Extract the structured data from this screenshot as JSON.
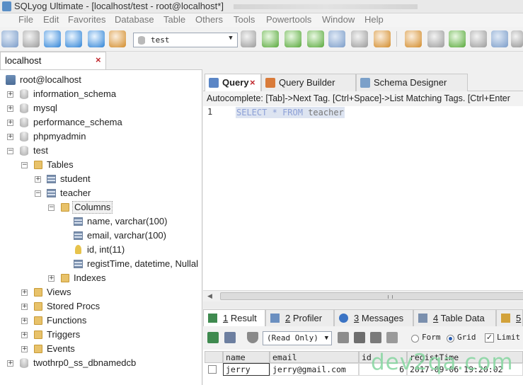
{
  "window": {
    "title": "SQLyog Ultimate - [localhost/test - root@localhost*]"
  },
  "menu": [
    "File",
    "Edit",
    "Favorites",
    "Database",
    "Table",
    "Others",
    "Tools",
    "Powertools",
    "Window",
    "Help"
  ],
  "toolbar": {
    "database_select": "test"
  },
  "connection_tab": {
    "label": "localhost",
    "close": "×"
  },
  "tree": {
    "root": "root@localhost",
    "nodes": {
      "information_schema": "information_schema",
      "mysql": "mysql",
      "performance_schema": "performance_schema",
      "phpmyadmin": "phpmyadmin",
      "test": "test",
      "tables": "Tables",
      "student": "student",
      "teacher": "teacher",
      "columns": "Columns",
      "col_name": "name, varchar(100)",
      "col_email": "email, varchar(100)",
      "col_id": "id, int(11)",
      "col_registtime": "registTime, datetime, Nullal",
      "indexes": "Indexes",
      "views": "Views",
      "stored_procs": "Stored Procs",
      "functions": "Functions",
      "triggers": "Triggers",
      "events": "Events",
      "twothrp0": "twothrp0_ss_dbnamedcb"
    },
    "expand": "+",
    "collapse": "−"
  },
  "query_tabs": [
    "Query",
    "Query Builder",
    "Schema Designer"
  ],
  "tab_close": "×",
  "autocomplete": "Autocomplete: [Tab]->Next Tag. [Ctrl+Space]->List Matching Tags. [Ctrl+Enter",
  "editor": {
    "line": "1",
    "kw1": "SELECT",
    "star": "*",
    "kw2": "FROM",
    "table": "teacher"
  },
  "result_tabs": [
    {
      "num": "1",
      "label": "Result"
    },
    {
      "num": "2",
      "label": "Profiler"
    },
    {
      "num": "3",
      "label": "Messages"
    },
    {
      "num": "4",
      "label": "Table Data"
    },
    {
      "num": "5",
      "label": ""
    }
  ],
  "result_toolbar": {
    "mode": "(Read Only)",
    "form": "Form",
    "grid": "Grid",
    "limit": "Limit",
    "limit_checked": "✓"
  },
  "grid": {
    "columns": [
      "name",
      "email",
      "id",
      "registTime"
    ],
    "rows": [
      [
        "jerry",
        "jerry@gmail.com",
        "6",
        "2017-09-06 19:20:02"
      ]
    ]
  },
  "watermark": "dev2qa.com",
  "colors": {
    "accent_close": "#c0282d",
    "selection": "#dde4f1",
    "keyword": "#8c9fd6",
    "watermark": "#86d6a0"
  }
}
